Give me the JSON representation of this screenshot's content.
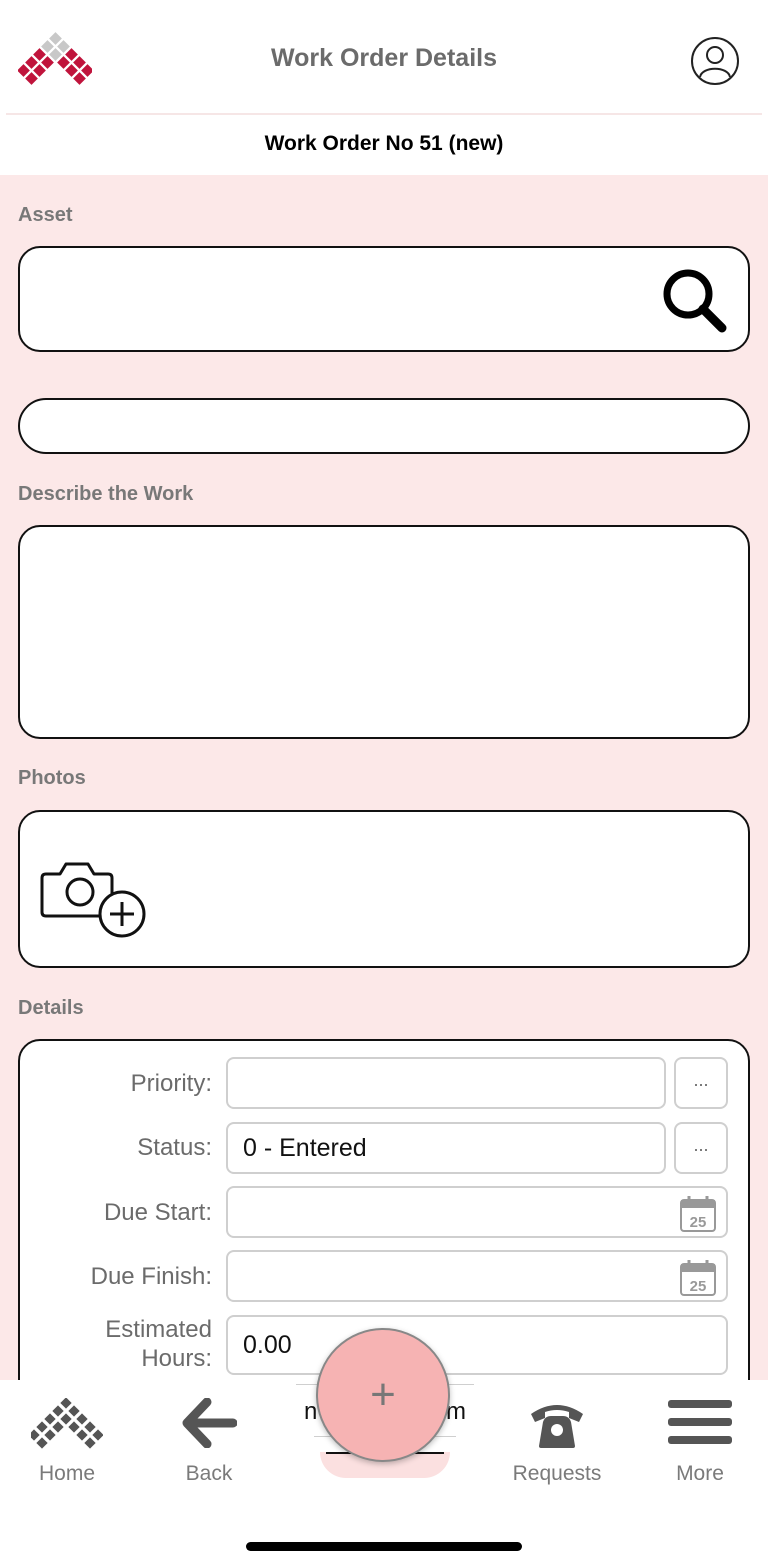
{
  "header": {
    "title": "Work Order Details",
    "logo_icon": "diamond-grid-logo",
    "profile_icon": "user-circle-icon"
  },
  "subheader": {
    "title": "Work Order No 51 (new)"
  },
  "form": {
    "asset_label": "Asset",
    "asset_value": "",
    "asset_description_value": "",
    "describe_label": "Describe the Work",
    "describe_value": "",
    "photos_label": "Photos",
    "details_label": "Details",
    "details": {
      "priority_label": "Priority:",
      "priority_value": "",
      "status_label": "Status:",
      "status_value": "0 - Entered",
      "due_start_label": "Due Start:",
      "due_start_value": "",
      "due_finish_label": "Due Finish:",
      "due_finish_value": "",
      "estimated_hours_label_line1": "Estimated",
      "estimated_hours_label_line2": "Hours:",
      "estimated_hours_value": "0.00",
      "lookup_button_label": "...",
      "calendar_day": "25"
    }
  },
  "tabbar": {
    "home_label": "Home",
    "back_label": "Back",
    "center_left_fragment": "n",
    "center_right_fragment": "m",
    "requests_label": "Requests",
    "more_label": "More"
  },
  "fab": {
    "label": "+"
  },
  "colors": {
    "brand_red": "#c0143c",
    "content_background": "#fce8e8",
    "fab_fill": "#f6b3b3",
    "label_gray": "#787878"
  }
}
